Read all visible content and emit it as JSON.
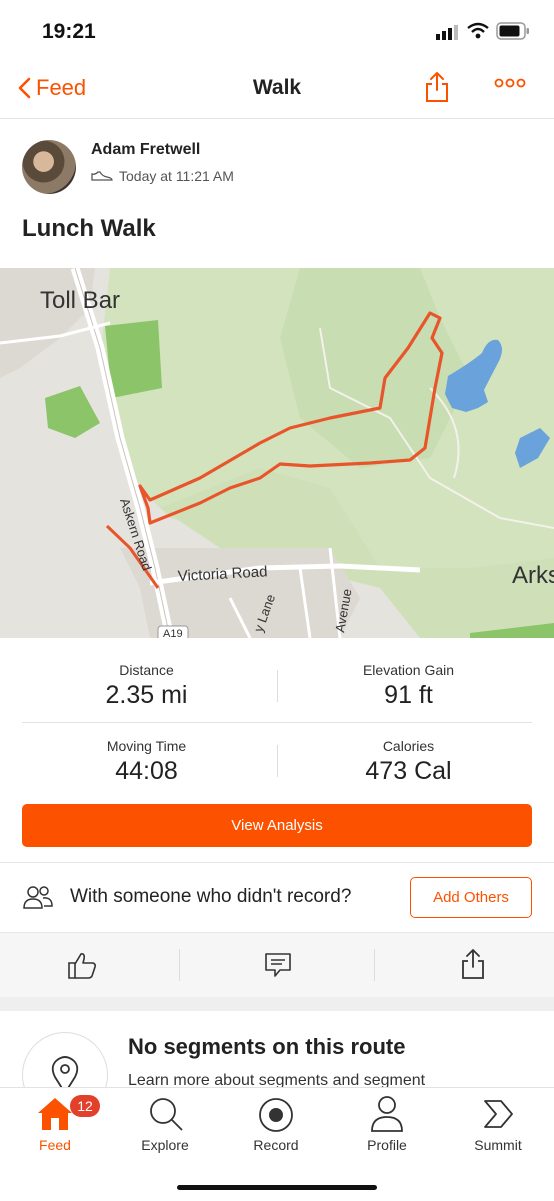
{
  "status_bar": {
    "time": "19:21"
  },
  "nav": {
    "back_label": "Feed",
    "title": "Walk"
  },
  "activity": {
    "athlete": "Adam Fretwell",
    "timestamp": "Today at 11:21 AM",
    "title": "Lunch Walk"
  },
  "map": {
    "labels": {
      "toll_bar": "Toll Bar",
      "askern_road": "Askern Road",
      "victoria_road": "Victoria Road",
      "lane": "y Lane",
      "avenue": "Avenue",
      "a19": "A19",
      "arks": "Arks"
    }
  },
  "stats": [
    {
      "label": "Distance",
      "value": "2.35 mi"
    },
    {
      "label": "Elevation Gain",
      "value": "91 ft"
    },
    {
      "label": "Moving Time",
      "value": "44:08"
    },
    {
      "label": "Calories",
      "value": "473 Cal"
    }
  ],
  "buttons": {
    "view_analysis": "View Analysis",
    "add_others": "Add Others"
  },
  "with_someone": "With someone who didn't record?",
  "segments": {
    "title": "No segments on this route",
    "subtitle": "Learn more about segments and segment"
  },
  "tabbar": {
    "items": [
      {
        "label": "Feed",
        "icon": "home-icon",
        "active": true
      },
      {
        "label": "Explore",
        "icon": "search-icon"
      },
      {
        "label": "Record",
        "icon": "record-icon"
      },
      {
        "label": "Profile",
        "icon": "person-icon"
      },
      {
        "label": "Summit",
        "icon": "summit-icon"
      }
    ],
    "feed_badge": "12"
  },
  "colors": {
    "accent": "#fc5200",
    "badge": "#e3402c",
    "route": "#e8552a"
  }
}
